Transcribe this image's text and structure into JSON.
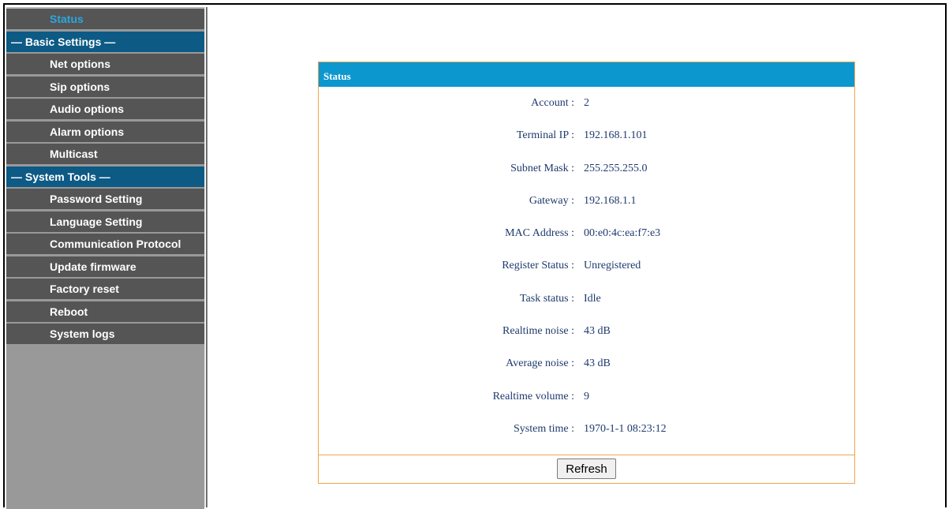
{
  "sidebar": {
    "items": [
      {
        "label": "Status",
        "type": "item",
        "active": true
      },
      {
        "label": "— Basic Settings —",
        "type": "head"
      },
      {
        "label": "Net options",
        "type": "item"
      },
      {
        "label": "Sip options",
        "type": "item"
      },
      {
        "label": "Audio options",
        "type": "item"
      },
      {
        "label": "Alarm options",
        "type": "item"
      },
      {
        "label": "Multicast",
        "type": "item"
      },
      {
        "label": "— System Tools —",
        "type": "head"
      },
      {
        "label": "Password Setting",
        "type": "item"
      },
      {
        "label": "Language Setting",
        "type": "item"
      },
      {
        "label": "Communication Protocol",
        "type": "item"
      },
      {
        "label": "Update firmware",
        "type": "item"
      },
      {
        "label": "Factory reset",
        "type": "item"
      },
      {
        "label": "Reboot",
        "type": "item"
      },
      {
        "label": "System logs",
        "type": "item"
      }
    ]
  },
  "panel": {
    "title": "Status",
    "rows": [
      {
        "label": "Account :",
        "value": "2"
      },
      {
        "label": "Terminal IP :",
        "value": "192.168.1.101"
      },
      {
        "label": "Subnet Mask :",
        "value": "255.255.255.0"
      },
      {
        "label": "Gateway :",
        "value": "192.168.1.1"
      },
      {
        "label": "MAC Address :",
        "value": "00:e0:4c:ea:f7:e3"
      },
      {
        "label": "Register Status :",
        "value": "Unregistered"
      },
      {
        "label": "Task status :",
        "value": "Idle"
      },
      {
        "label": "Realtime noise :",
        "value": "43 dB"
      },
      {
        "label": "Average noise :",
        "value": "43 dB"
      },
      {
        "label": "Realtime volume :",
        "value": "9"
      },
      {
        "label": "System time :",
        "value": "1970-1-1 08:23:12"
      }
    ],
    "refresh_label": "Refresh"
  }
}
